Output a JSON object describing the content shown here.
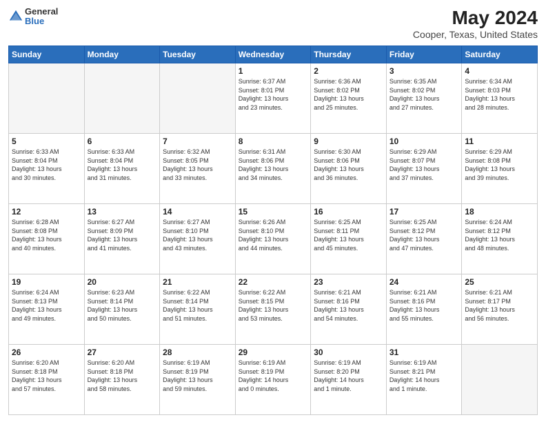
{
  "header": {
    "logo_general": "General",
    "logo_blue": "Blue",
    "title": "May 2024",
    "subtitle": "Cooper, Texas, United States"
  },
  "weekdays": [
    "Sunday",
    "Monday",
    "Tuesday",
    "Wednesday",
    "Thursday",
    "Friday",
    "Saturday"
  ],
  "weeks": [
    [
      {
        "day": "",
        "info": ""
      },
      {
        "day": "",
        "info": ""
      },
      {
        "day": "",
        "info": ""
      },
      {
        "day": "1",
        "info": "Sunrise: 6:37 AM\nSunset: 8:01 PM\nDaylight: 13 hours\nand 23 minutes."
      },
      {
        "day": "2",
        "info": "Sunrise: 6:36 AM\nSunset: 8:02 PM\nDaylight: 13 hours\nand 25 minutes."
      },
      {
        "day": "3",
        "info": "Sunrise: 6:35 AM\nSunset: 8:02 PM\nDaylight: 13 hours\nand 27 minutes."
      },
      {
        "day": "4",
        "info": "Sunrise: 6:34 AM\nSunset: 8:03 PM\nDaylight: 13 hours\nand 28 minutes."
      }
    ],
    [
      {
        "day": "5",
        "info": "Sunrise: 6:33 AM\nSunset: 8:04 PM\nDaylight: 13 hours\nand 30 minutes."
      },
      {
        "day": "6",
        "info": "Sunrise: 6:33 AM\nSunset: 8:04 PM\nDaylight: 13 hours\nand 31 minutes."
      },
      {
        "day": "7",
        "info": "Sunrise: 6:32 AM\nSunset: 8:05 PM\nDaylight: 13 hours\nand 33 minutes."
      },
      {
        "day": "8",
        "info": "Sunrise: 6:31 AM\nSunset: 8:06 PM\nDaylight: 13 hours\nand 34 minutes."
      },
      {
        "day": "9",
        "info": "Sunrise: 6:30 AM\nSunset: 8:06 PM\nDaylight: 13 hours\nand 36 minutes."
      },
      {
        "day": "10",
        "info": "Sunrise: 6:29 AM\nSunset: 8:07 PM\nDaylight: 13 hours\nand 37 minutes."
      },
      {
        "day": "11",
        "info": "Sunrise: 6:29 AM\nSunset: 8:08 PM\nDaylight: 13 hours\nand 39 minutes."
      }
    ],
    [
      {
        "day": "12",
        "info": "Sunrise: 6:28 AM\nSunset: 8:08 PM\nDaylight: 13 hours\nand 40 minutes."
      },
      {
        "day": "13",
        "info": "Sunrise: 6:27 AM\nSunset: 8:09 PM\nDaylight: 13 hours\nand 41 minutes."
      },
      {
        "day": "14",
        "info": "Sunrise: 6:27 AM\nSunset: 8:10 PM\nDaylight: 13 hours\nand 43 minutes."
      },
      {
        "day": "15",
        "info": "Sunrise: 6:26 AM\nSunset: 8:10 PM\nDaylight: 13 hours\nand 44 minutes."
      },
      {
        "day": "16",
        "info": "Sunrise: 6:25 AM\nSunset: 8:11 PM\nDaylight: 13 hours\nand 45 minutes."
      },
      {
        "day": "17",
        "info": "Sunrise: 6:25 AM\nSunset: 8:12 PM\nDaylight: 13 hours\nand 47 minutes."
      },
      {
        "day": "18",
        "info": "Sunrise: 6:24 AM\nSunset: 8:12 PM\nDaylight: 13 hours\nand 48 minutes."
      }
    ],
    [
      {
        "day": "19",
        "info": "Sunrise: 6:24 AM\nSunset: 8:13 PM\nDaylight: 13 hours\nand 49 minutes."
      },
      {
        "day": "20",
        "info": "Sunrise: 6:23 AM\nSunset: 8:14 PM\nDaylight: 13 hours\nand 50 minutes."
      },
      {
        "day": "21",
        "info": "Sunrise: 6:22 AM\nSunset: 8:14 PM\nDaylight: 13 hours\nand 51 minutes."
      },
      {
        "day": "22",
        "info": "Sunrise: 6:22 AM\nSunset: 8:15 PM\nDaylight: 13 hours\nand 53 minutes."
      },
      {
        "day": "23",
        "info": "Sunrise: 6:21 AM\nSunset: 8:16 PM\nDaylight: 13 hours\nand 54 minutes."
      },
      {
        "day": "24",
        "info": "Sunrise: 6:21 AM\nSunset: 8:16 PM\nDaylight: 13 hours\nand 55 minutes."
      },
      {
        "day": "25",
        "info": "Sunrise: 6:21 AM\nSunset: 8:17 PM\nDaylight: 13 hours\nand 56 minutes."
      }
    ],
    [
      {
        "day": "26",
        "info": "Sunrise: 6:20 AM\nSunset: 8:18 PM\nDaylight: 13 hours\nand 57 minutes."
      },
      {
        "day": "27",
        "info": "Sunrise: 6:20 AM\nSunset: 8:18 PM\nDaylight: 13 hours\nand 58 minutes."
      },
      {
        "day": "28",
        "info": "Sunrise: 6:19 AM\nSunset: 8:19 PM\nDaylight: 13 hours\nand 59 minutes."
      },
      {
        "day": "29",
        "info": "Sunrise: 6:19 AM\nSunset: 8:19 PM\nDaylight: 14 hours\nand 0 minutes."
      },
      {
        "day": "30",
        "info": "Sunrise: 6:19 AM\nSunset: 8:20 PM\nDaylight: 14 hours\nand 1 minute."
      },
      {
        "day": "31",
        "info": "Sunrise: 6:19 AM\nSunset: 8:21 PM\nDaylight: 14 hours\nand 1 minute."
      },
      {
        "day": "",
        "info": ""
      }
    ]
  ]
}
